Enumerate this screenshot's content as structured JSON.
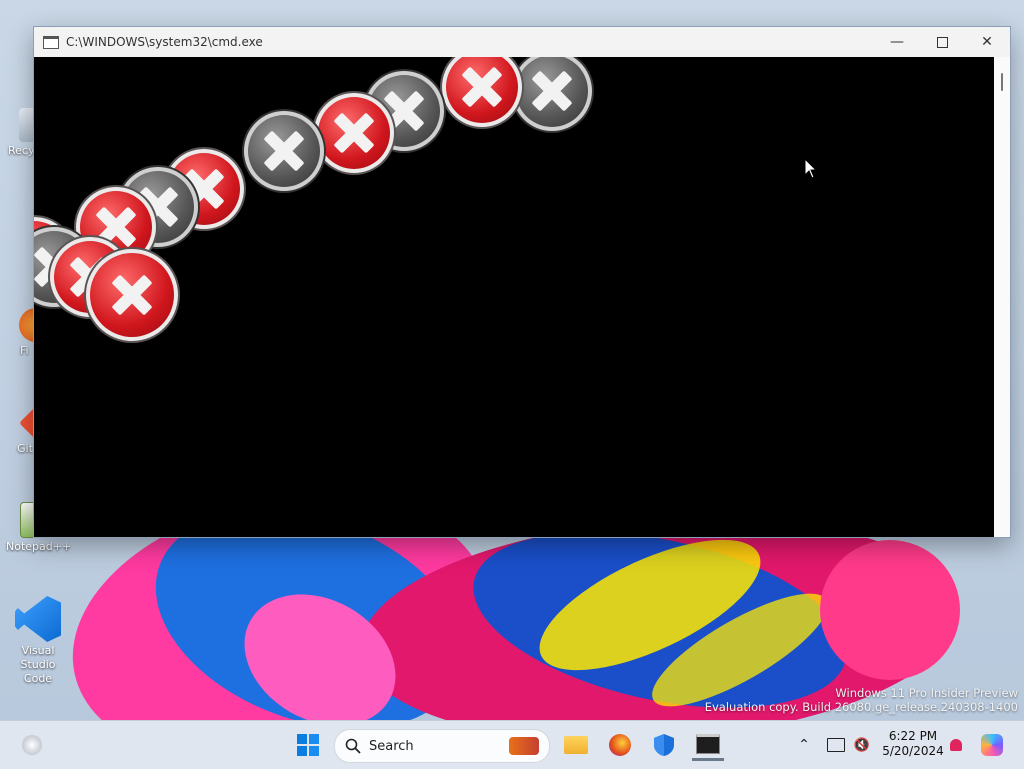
{
  "window": {
    "title": "C:\\WINDOWS\\system32\\cmd.exe",
    "controls": [
      "minimize-icon",
      "maximize-icon",
      "close-icon"
    ]
  },
  "desktop": {
    "icons": [
      {
        "label": "Recy",
        "icon": "recycle-bin-icon"
      },
      {
        "label": "Fi",
        "icon": "firefox-icon"
      },
      {
        "label": "Git",
        "icon": "git-icon"
      },
      {
        "label": "Notepad++",
        "icon": "notepad-plus-plus-icon"
      },
      {
        "label": "Visual Studio Code",
        "icon": "vscode-icon"
      }
    ],
    "watermark": {
      "line1": "Windows 11 Pro Insider Preview",
      "line2": "Evaluation copy. Build 26080.ge_release.240308-1400"
    }
  },
  "taskbar": {
    "search_label": "Search",
    "apps": [
      "start-icon",
      "file-explorer-icon",
      "firefox-icon",
      "windows-security-icon",
      "terminal-icon"
    ],
    "tray_icons": [
      "chevron-up-icon",
      "network-icon",
      "volume-muted-icon",
      "notification-bell-icon",
      "copilot-icon"
    ],
    "time": "6:22 PM",
    "date": "5/20/2024"
  },
  "colors": {
    "error_red": "#d0161d",
    "console_bg": "#000000",
    "taskbar_bg": "#dfe6ef"
  }
}
